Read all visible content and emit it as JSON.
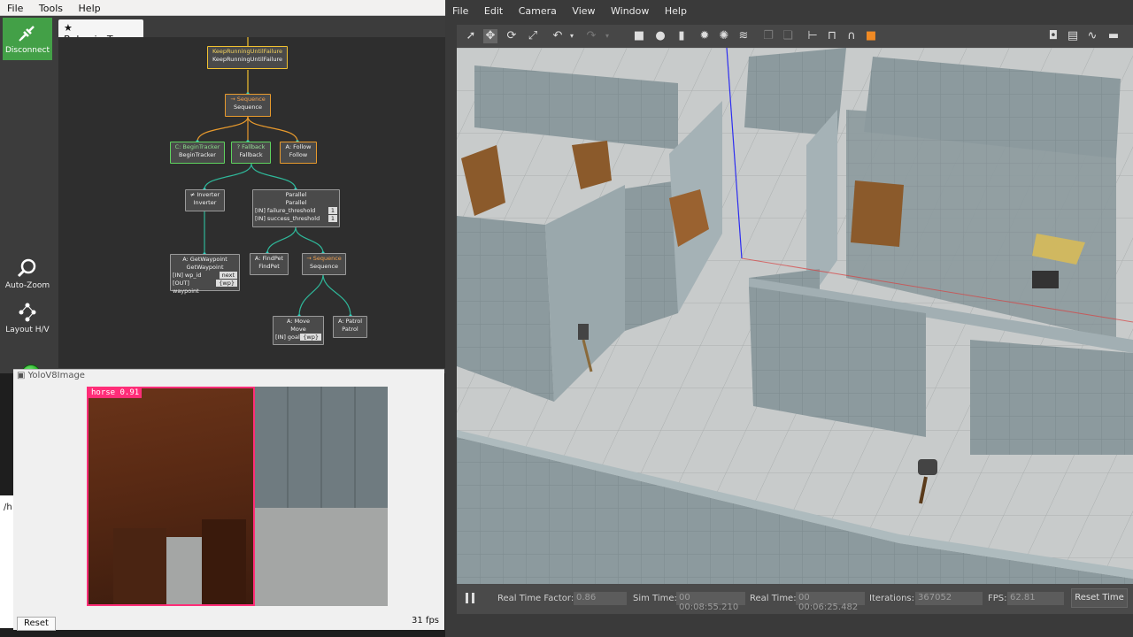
{
  "groot": {
    "menu": [
      "File",
      "Tools",
      "Help"
    ],
    "disconnect_label": "Disconnect",
    "autozoom_label": "Auto-Zoom",
    "layout_label": "Layout H/V",
    "tab_label": "BehaviorTree",
    "nodes": {
      "root": {
        "title": "KeepRunningUntilFailure",
        "sub": "KeepRunningUntilFailure"
      },
      "seq1": {
        "title": "→ Sequence",
        "sub": "Sequence"
      },
      "begin": {
        "title": "C: BeginTracker",
        "sub": "BeginTracker"
      },
      "fallback": {
        "title": "? Fallback",
        "sub": "Fallback"
      },
      "follow": {
        "title": "A: Follow",
        "sub": "Follow"
      },
      "inverter": {
        "title": "≠ Inverter",
        "sub": "Inverter"
      },
      "parallel": {
        "title": "Parallel",
        "sub": "Parallel",
        "p1": "[IN] failure_threshold",
        "v1": "1",
        "p2": "[IN] success_threshold",
        "v2": "1"
      },
      "getwp": {
        "title": "A: GetWaypoint",
        "sub": "GetWaypoint",
        "p1": "[IN] wp_id",
        "v1": "next",
        "p2": "[OUT] waypoint",
        "v2": "{wp}"
      },
      "findpet": {
        "title": "A: FindPet",
        "sub": "FindPet"
      },
      "seq2": {
        "title": "→ Sequence",
        "sub": "Sequence"
      },
      "move": {
        "title": "A: Move",
        "sub": "Move",
        "p1": "[IN] goal",
        "v1": "{wp}"
      },
      "patrol": {
        "title": "A: Patrol",
        "sub": "Patrol"
      }
    }
  },
  "yolo": {
    "title": "YoloV8Image",
    "detection_label": "horse  0.91",
    "reset_label": "Reset",
    "fps": "31 fps"
  },
  "terminal": {
    "text": "/h"
  },
  "gazebo": {
    "menu": [
      "File",
      "Edit",
      "Camera",
      "View",
      "Window",
      "Help"
    ],
    "status": {
      "rtf_label": "Real Time Factor:",
      "rtf": "0.86",
      "sim_label": "Sim Time:",
      "sim": "00 00:08:55.210",
      "real_label": "Real Time:",
      "real": "00 00:06:25.482",
      "iter_label": "Iterations:",
      "iter": "367052",
      "fps_label": "FPS:",
      "fps": "62.81",
      "reset_label": "Reset Time"
    }
  }
}
